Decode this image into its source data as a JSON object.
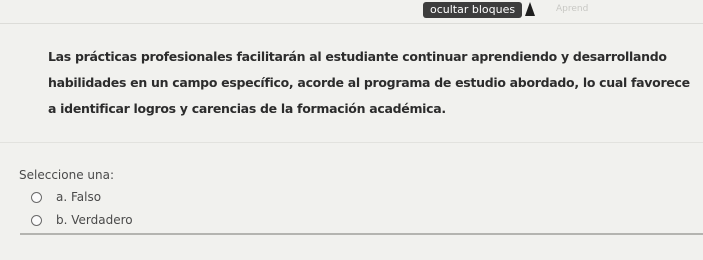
{
  "toolbar": {
    "hide_blocks_label": "ocultar bloques",
    "faded_label": "Aprend"
  },
  "question": {
    "text": "Las prácticas profesionales facilitarán al estudiante continuar aprendiendo y desarrollando habilidades en un campo específico, acorde al programa de estudio abordado, lo cual favorece a identificar logros y carencias de la formación académica.",
    "prompt": "Seleccione una:",
    "options": [
      {
        "label": "a. Falso"
      },
      {
        "label": "b. Verdadero"
      }
    ]
  }
}
